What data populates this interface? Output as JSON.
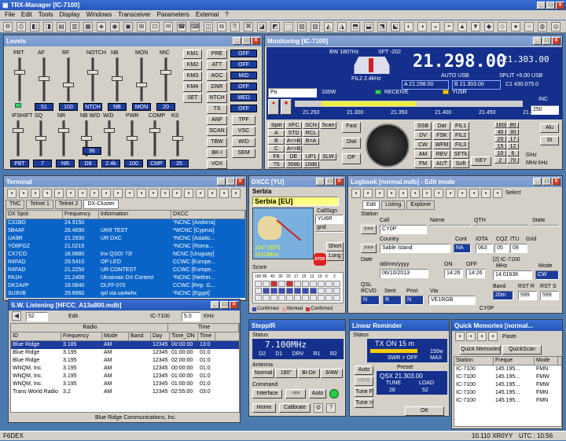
{
  "app": {
    "title": "TRX-Manager [IC-7100]"
  },
  "menu": [
    "File",
    "Edit",
    "Tools",
    "Display",
    "Windows",
    "Transceiver",
    "Parameters",
    "External",
    "?"
  ],
  "levels": {
    "title": "Levels",
    "top_labels": [
      "PBT",
      "AF",
      "RF",
      "NOTCH",
      "NB",
      "MON",
      "MIC"
    ],
    "top_values": [
      "51",
      "100",
      "NTCH",
      "NB",
      "MON",
      "20"
    ],
    "bot_labels": [
      "IFSHIFT",
      "SQ",
      "NR",
      "NB W/D",
      "W/D",
      "PWR",
      "COMP",
      "KS"
    ],
    "bot_values": [
      "PBT",
      "7",
      "NR",
      "D8",
      "2.4k",
      "100",
      "CMP",
      "25"
    ],
    "bot_extra": "96",
    "km": [
      "KM1",
      "KM2",
      "KM3",
      "KM4",
      "SET"
    ],
    "right_btns": [
      "PRE",
      "ATT",
      "AGC",
      "DNR",
      "NTCH",
      "TS",
      "ANF",
      "SCAN",
      "TBW",
      "BK-I",
      "VOX"
    ],
    "right_vals": [
      "OFF",
      "OFF",
      "MID",
      "OFF",
      "MED",
      "OFF"
    ],
    "right_btns2": [
      "TPF",
      "VSC",
      "W/D",
      "SEM"
    ]
  },
  "monitoring": {
    "title": "Monitoring [IC-7100]",
    "bw": "BW 1807Hz",
    "sft": "SFT -202",
    "freq": "21.298.00",
    "freq_b": "21.303.00",
    "mode": "AUTO USB",
    "split": "SPLIT +5.00 USB",
    "fil": "FIL2 2.4kHz",
    "mem_a": "A 21.298.00",
    "mem_b": "B 21.303.00",
    "mem_c": "C1 430.075.0",
    "po_sel": "Po",
    "power": "100W",
    "receive": "RECEIVE",
    "call": "YU5R",
    "scale": [
      "21.250",
      "21.300",
      "21.350",
      "21.400",
      "21.450",
      "21.500"
    ],
    "inc": "INC",
    "inc_val": "250",
    "grid_btns": [
      [
        "Split",
        "XFC",
        "SCN",
        "Scan"
      ],
      [
        "A",
        "STD",
        "RCL",
        ""
      ],
      [
        "B",
        "A<>B",
        "B=A",
        ""
      ],
      [
        "C",
        "A<>B",
        "",
        ""
      ],
      [
        "F6",
        "DE",
        "UP1",
        "SLW"
      ],
      [
        "?S",
        "30db",
        "10db",
        ""
      ]
    ],
    "mid_btns": [
      "Fast",
      "Dial",
      "OP"
    ],
    "mode_btns": [
      [
        "SSB",
        "Dat",
        "FIL1"
      ],
      [
        "DV",
        "FSK",
        "FIL2"
      ],
      [
        "CW",
        "WFM",
        "FIL3"
      ],
      [
        "AM",
        "REV",
        "SFTk"
      ],
      [
        "FM",
        "AUT",
        "Soft"
      ]
    ],
    "keypad": [
      "160",
      "80",
      "40",
      "30",
      "20",
      "17",
      "15",
      "12",
      "10",
      "6",
      "2",
      "70"
    ],
    "key": "KEY",
    "ghz": "GHz",
    "mhz": "MHz",
    "khz": "kHz",
    "alu": "Alu",
    "st": "St"
  },
  "terminal": {
    "title": "Terminal",
    "tabs": [
      "TNC",
      "Telnet 1",
      "Telnet 2",
      "DX-Cluster"
    ],
    "cols": [
      "DX Spot",
      "Frequency",
      "Information",
      "DXCC"
    ],
    "rows": [
      [
        "C31BO",
        "24.9150",
        "",
        "*NCNC [Andorra]"
      ],
      [
        "5B4AF",
        "28.4690",
        "UKR TEST",
        "*WCNC [Cyprus]"
      ],
      [
        "UA9R",
        "21.2930",
        "UR DXC",
        "*NCNC [Asiatic..."
      ],
      [
        "YO6FGZ",
        "21.0215",
        "",
        "*NCNC [Roma..."
      ],
      [
        "CX7CO",
        "18.0880",
        "tnx QSO! 73!",
        "NCNC [Uruguay]"
      ],
      [
        "R4FAD",
        "29.5410",
        "OP LEO",
        "CCWC [Europe..."
      ],
      [
        "R4FAD",
        "21.2250",
        "UR CONTEST",
        "CCWC [Europe..."
      ],
      [
        "PA1H",
        "21.2409",
        "Ukrainian DX Contest",
        "*NCNC [Nether..."
      ],
      [
        "DK2AI/P",
        "18.0840",
        "DLFF-070",
        "CCWC [Rep. G..."
      ],
      [
        "SU9VB",
        "29.8960",
        "qsl via ua4whx",
        "*NCNC [Egypt]"
      ]
    ]
  },
  "dxcc": {
    "title": "DXCC [YU]",
    "country": "Serbia",
    "entity": "Serbia [EU]",
    "callsign_lbl": "CallSign",
    "callsign": "YU6R",
    "grid_lbl": "grid",
    "short": "Short",
    "long": "Long",
    "bearing": "114° (307)",
    "dist": "15126Km",
    "stop": "STOP",
    "score": "Score",
    "score_bands": [
      "160",
      "80",
      "40",
      "30",
      "20",
      "17",
      "15",
      "12",
      "10",
      "6",
      "2"
    ],
    "legend": [
      "Confirmed",
      "Worked",
      "Confirmed"
    ]
  },
  "logbook": {
    "title": "Logbook [normal.mdb] - Edit mode",
    "select": "Select",
    "tabs": [
      "Edit",
      "Listing",
      "Explorer"
    ],
    "station": "Station",
    "call_lbl": "Call",
    "name_lbl": "Name",
    "qth_lbl": "QTH",
    "state_lbl": "State",
    "call": "CY0P",
    "country_lbl": "Country",
    "country": "Sable Island",
    "cont_lbl": "Cont",
    "cont": "NA",
    "iota_lbl": "IOTA",
    "cqz_lbl": "CQZ",
    "itu_lbl": "ITU",
    "grid_lbl": "Grid",
    "cqz": "063",
    "itu": "05",
    "grid": "09",
    "date_lbl": "Date",
    "date_fmt": "dd/mm/yyyy",
    "on_lbl": "ON",
    "off_lbl": "OFF",
    "date": "06/10/2013",
    "on": "14:26",
    "off": "14:26",
    "rig_lbl": "[2] IC-7100",
    "mhz_lbl": "MHz",
    "mode_lbl": "Mode",
    "mhz": "14.01636",
    "mode": "CW",
    "qsl_lbl": "QSL",
    "rcvd_lbl": "RCVD",
    "sent_lbl": "Sent",
    "print_lbl": "Print",
    "via_lbl": "Via",
    "rcvd": "N",
    "sent": "R",
    "print": "N",
    "via": "VE1RGB",
    "band_lbl": "Band",
    "rstr_lbl": "RST R",
    "rsts_lbl": "RST S",
    "band": "20m",
    "rstr": "599",
    "rsts": "599",
    "bottom_call": "CY0P"
  },
  "swl": {
    "title": "S.W. Listening [HFCC_A13a800.mdb]",
    "page": "52",
    "edit": "Edit",
    "rig": "IC-7100",
    "step": "5.0",
    "khz": "KHz",
    "group_radio": "Radio",
    "group_time": "Time",
    "cols": [
      "ID",
      "Frequency",
      "Mode",
      "Band",
      "Day",
      "Time_ON",
      "Time"
    ],
    "rows": [
      [
        "Blue Ridge",
        "3.185",
        "AM",
        "",
        "12345",
        "00:00:00",
        "13:0"
      ],
      [
        "Blue Ridge",
        "3.195",
        "AM",
        "",
        "12345",
        "01:00:00",
        "01:0"
      ],
      [
        "Blue Ridge",
        "3.195",
        "AM",
        "",
        "12345",
        "02:00:00",
        "01:0"
      ],
      [
        "WNQM, Inc.",
        "3.195",
        "AM",
        "",
        "12345",
        "00:00:00",
        "01:0"
      ],
      [
        "WNQM, Inc.",
        "3.195",
        "AM",
        "",
        "12345",
        "01:00:00",
        "01:0"
      ],
      [
        "WNQM, Inc.",
        "3.195",
        "AM",
        "",
        "12345",
        "01:00:00",
        "01:0"
      ],
      [
        "Trans World Radio",
        "3.2",
        "AM",
        "",
        "12345",
        "02:55:00",
        "03:0"
      ]
    ],
    "footer": "Blue Ridge Communications, Inc."
  },
  "steppir": {
    "title": "SteppIR",
    "status_lbl": "Status",
    "freq": "7.100MHz",
    "elems": [
      "D2",
      "D1",
      "DRV",
      "R1",
      "R2"
    ],
    "antenna_lbl": "Antenna",
    "ant_btns": [
      "Normal",
      "180°",
      "Bi-Dir",
      "3/4W"
    ],
    "command_lbl": "Command",
    "interface": "Interface",
    "arrow": "->>",
    "auto": "Auto",
    "home": "Home",
    "calibrate": "Calibrate"
  },
  "linear": {
    "title": "Linear Reminder",
    "status_lbl": "Status",
    "tx": "TX ON 15 m",
    "watts": "150w",
    "swr": "SWR > OFF",
    "max": "MAX",
    "auto": "Auto",
    "opr": "OPR",
    "tunef": "Tune F.",
    "tune_arrow": "Tune >",
    "preset_lbl": "Preset",
    "qsx": "QSX 21.303.00",
    "tune_lbl": "TUNE",
    "load_lbl": "LOAD",
    "tune": "28",
    "load": "52",
    "ok": "OK"
  },
  "qmem": {
    "title": "Quick Memories [normal...",
    "paste": "Paste",
    "tab1": "Quick Memories",
    "tab2": "QuickScan",
    "cols": [
      "Station",
      "Freque",
      "Mode"
    ],
    "rows": [
      [
        "IC-7100",
        "145.195...",
        "FMN"
      ],
      [
        "IC-7100",
        "145.195...",
        "FMW"
      ],
      [
        "IC-7100",
        "145.195...",
        "FMW"
      ],
      [
        "IC-7100",
        "145.195...",
        "FMN"
      ],
      [
        "IC-7100",
        "145.195...",
        "FMN"
      ]
    ]
  },
  "status": {
    "left": "F6DEX",
    "freq": "10.110 XR0YY",
    "utc": "UTC : 10:56"
  },
  "colors": {
    "accent": "#2558b8",
    "lcd": "#14308c",
    "spot_bg": "#0a64c8"
  }
}
